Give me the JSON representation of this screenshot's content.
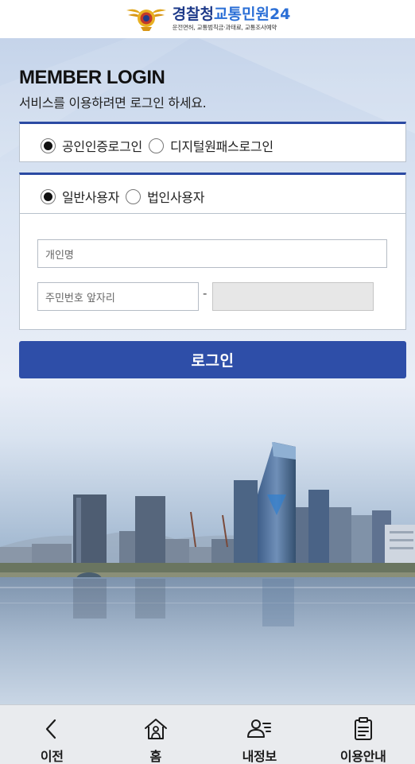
{
  "header": {
    "logo_org": "경찰청",
    "logo_service": "교통민원24",
    "logo_sub": "운전면허, 교통범칙금·과태료, 교통조사예약"
  },
  "login": {
    "title": "MEMBER LOGIN",
    "subtitle": "서비스를 이용하려면 로그인 하세요.",
    "cert_options": [
      {
        "label": "공인인증로그인",
        "selected": true
      },
      {
        "label": "디지털원패스로그인",
        "selected": false
      }
    ],
    "user_options": [
      {
        "label": "일반사용자",
        "selected": true
      },
      {
        "label": "법인사용자",
        "selected": false
      }
    ],
    "name_placeholder": "개인명",
    "jumin_front_placeholder": "주민번호 앞자리",
    "jumin_separator": "-",
    "jumin_back_placeholder": "",
    "submit_label": "로그인"
  },
  "bottom_nav": {
    "items": [
      {
        "label": "이전",
        "icon": "back-chevron-icon"
      },
      {
        "label": "홈",
        "icon": "home-icon"
      },
      {
        "label": "내정보",
        "icon": "my-info-icon"
      },
      {
        "label": "이용안내",
        "icon": "clipboard-guide-icon"
      }
    ]
  },
  "colors": {
    "primary": "#2e4ea8",
    "box_border_top": "#2b4aa3",
    "nav_bg": "#e9ebee"
  }
}
